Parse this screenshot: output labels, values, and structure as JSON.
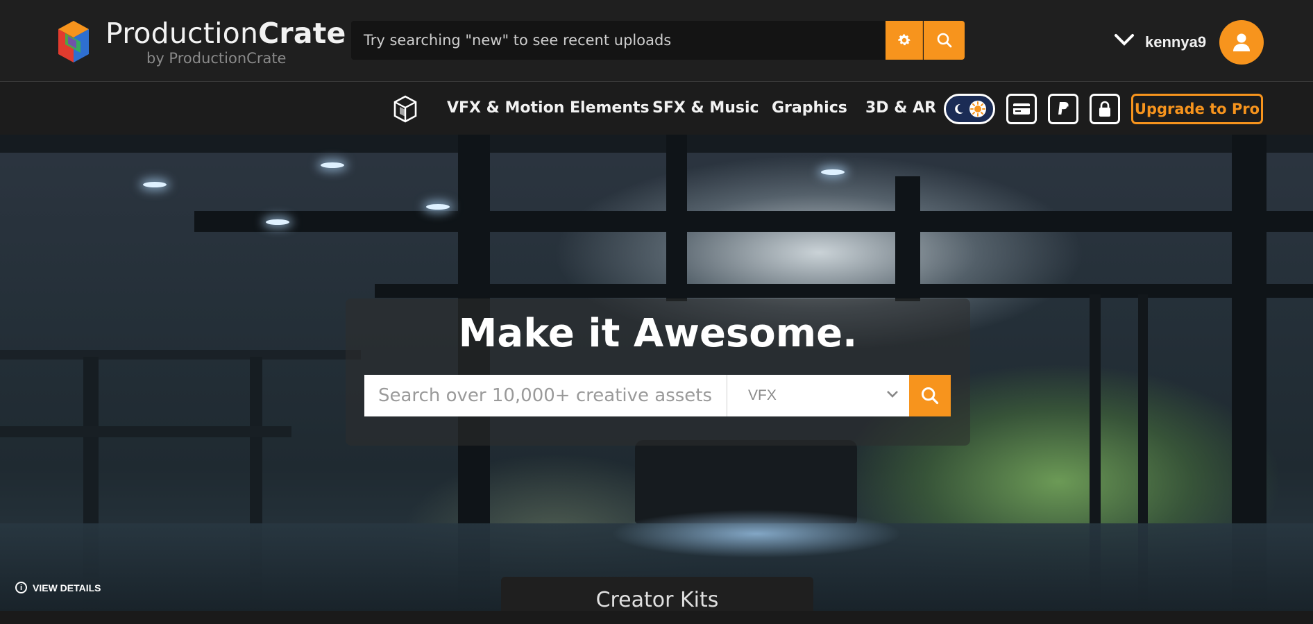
{
  "colors": {
    "accent": "#f7941d",
    "header_bg": "#1f1f1f",
    "nav_bg": "#1c1c1c"
  },
  "header": {
    "brand_first": "Production",
    "brand_second": "Crate",
    "brand_sub": "by ProductionCrate",
    "search_placeholder": "Try searching \"new\" to see recent uploads",
    "settings_icon": "gear-icon",
    "search_icon": "search-icon",
    "username": "kennya9",
    "user_menu_icon": "chevron-down-icon",
    "avatar_icon": "user-icon"
  },
  "nav": {
    "items": [
      {
        "label": "VFX & Motion Elements"
      },
      {
        "label": "SFX & Music"
      },
      {
        "label": "Graphics"
      },
      {
        "label": "3D & AR"
      }
    ],
    "theme_toggle_icons": [
      "moon-icon",
      "sun-icon"
    ],
    "icon_buttons": [
      "credit-card-icon",
      "paypal-icon",
      "lock-icon"
    ],
    "upgrade_label": "Upgrade to Pro"
  },
  "hero": {
    "title": "Make it Awesome.",
    "search_placeholder": "Search over 10,000+ creative assets",
    "category_selected": "VFX",
    "view_details": "VIEW DETAILS"
  },
  "footer_tab": {
    "label": "Creator Kits"
  }
}
